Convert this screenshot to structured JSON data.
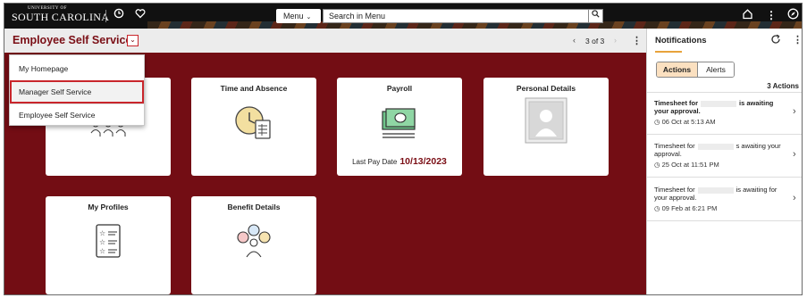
{
  "topbar": {
    "logo_small": "UNIVERSITY OF",
    "logo_large": "SOUTH CAROLINA",
    "menu_label": "Menu",
    "search_placeholder": "Search in Menu",
    "icons": [
      "history-icon",
      "favorites-icon",
      "home-icon",
      "actions-icon",
      "navbar-icon"
    ]
  },
  "header": {
    "title": "Employee Self Service",
    "pager": "3 of 3"
  },
  "dropdown": {
    "items": [
      "My Homepage",
      "Manager Self Service",
      "Employee Self Service"
    ],
    "highlighted": "Manager Self Service"
  },
  "tiles": {
    "time_absence": "Time and Absence",
    "payroll": "Payroll",
    "payroll_foot_label": "Last Pay Date",
    "payroll_foot_date": "10/13/2023",
    "personal_details": "Personal Details",
    "my_profiles": "My Profiles",
    "benefit_details": "Benefit Details"
  },
  "notifications": {
    "title": "Notifications",
    "tabs": [
      "Actions",
      "Alerts"
    ],
    "active_tab": "Actions",
    "count": "3 Actions",
    "items": [
      {
        "pre": "Timesheet for",
        "post": "is awaiting your approval.",
        "time": "06 Oct at 5:13 AM",
        "bold": true
      },
      {
        "pre": "Timesheet for",
        "post": "s awaiting your approval.",
        "time": "25 Oct at 11:51 PM",
        "bold": false
      },
      {
        "pre": "Timesheet for",
        "post": "is awaiting for your approval.",
        "time": "09 Feb at 6:21 PM",
        "bold": false
      }
    ]
  },
  "colors": {
    "garnet": "#730d14",
    "title_red": "#7a0e15",
    "highlight_red": "#c9262c",
    "topbar": "#111111",
    "active_tab": "#fbe0c0",
    "accent": "#e8a33b"
  }
}
